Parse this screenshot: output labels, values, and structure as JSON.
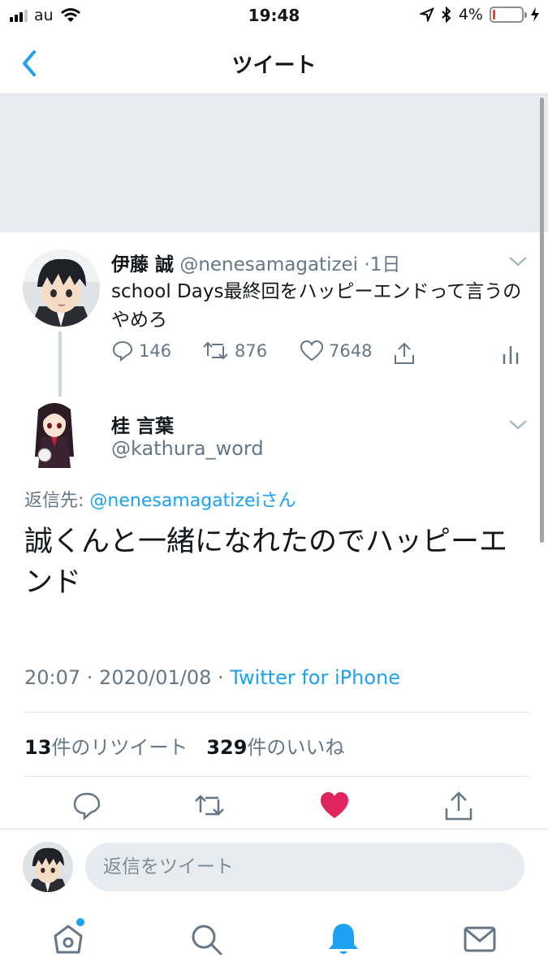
{
  "status_bar": {
    "carrier": "au",
    "time": "19:48",
    "battery": "4%",
    "battery_level": 0.04
  },
  "nav": {
    "title": "ツイート"
  },
  "parent_tweet": {
    "name": "伊藤 誠",
    "handle": "@nenesamagatizei",
    "age": "·1日",
    "text": "school Days最終回をハッピーエンドって言うのやめろ",
    "replies": "146",
    "retweets": "876",
    "likes": "7648"
  },
  "reply_tweet": {
    "name": "桂 言葉",
    "handle": "@kathura_word",
    "reply_to_prefix": "返信先: ",
    "reply_to_handle": "@nenesamagatizeiさん",
    "text": "誠くんと一緒になれたのでハッピーエンド",
    "timestamp": "20:07 · 2020/01/08 · ",
    "source": "Twitter for iPhone",
    "retweet_count": "13",
    "retweet_label": "件のリツイート",
    "like_count": "329",
    "like_label": "件のいいね"
  },
  "reply_box": {
    "placeholder": "返信をツイート"
  },
  "colors": {
    "accent": "#1da1f2",
    "like": "#e0245e",
    "muted": "#657786"
  }
}
